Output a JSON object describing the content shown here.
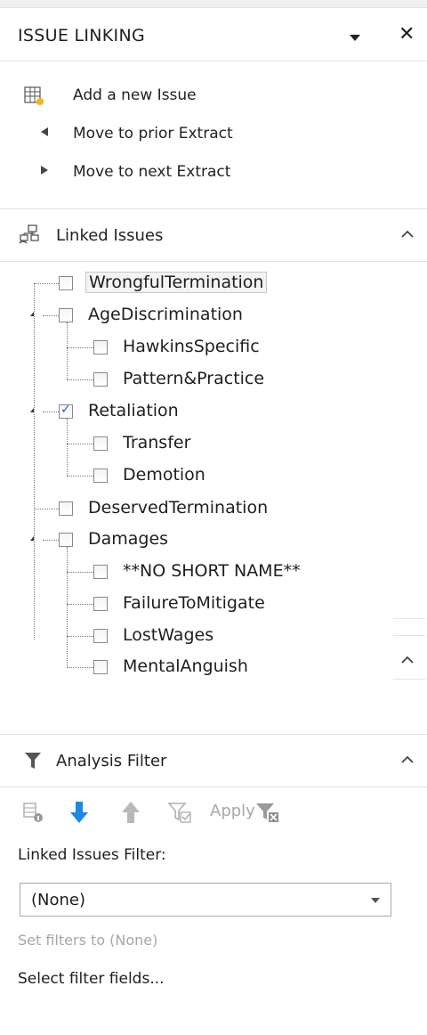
{
  "header": {
    "title": "ISSUE LINKING"
  },
  "actions": {
    "add_issue": "Add a new Issue",
    "prior_extract": "Move to prior Extract",
    "next_extract": "Move to next Extract"
  },
  "linked_issues": {
    "title": "Linked Issues",
    "tree": {
      "wrongful_termination": "WrongfulTermination",
      "age_discrimination": "AgeDiscrimination",
      "hawkins_specific": "HawkinsSpecific",
      "pattern_practice": "Pattern&Practice",
      "retaliation": "Retaliation",
      "transfer": "Transfer",
      "demotion": "Demotion",
      "deserved_termination": "DeservedTermination",
      "damages": "Damages",
      "no_short_name": "**NO SHORT NAME**",
      "failure_to_mitigate": "FailureToMitigate",
      "lost_wages": "LostWages",
      "mental_anguish": "MentalAnguish"
    },
    "checked": [
      "Retaliation"
    ]
  },
  "analysis_filter": {
    "title": "Analysis Filter",
    "apply_label": "Apply",
    "linked_issues_filter_label": "Linked Issues Filter:",
    "selected_value": "(None)",
    "set_filters_none": "Set filters to (None)",
    "select_filter_fields": "Select filter fields..."
  },
  "colors": {
    "accent_blue": "#1e88e5",
    "check_blue": "#2a5bd7",
    "disabled_gray": "#a8a8a8"
  }
}
